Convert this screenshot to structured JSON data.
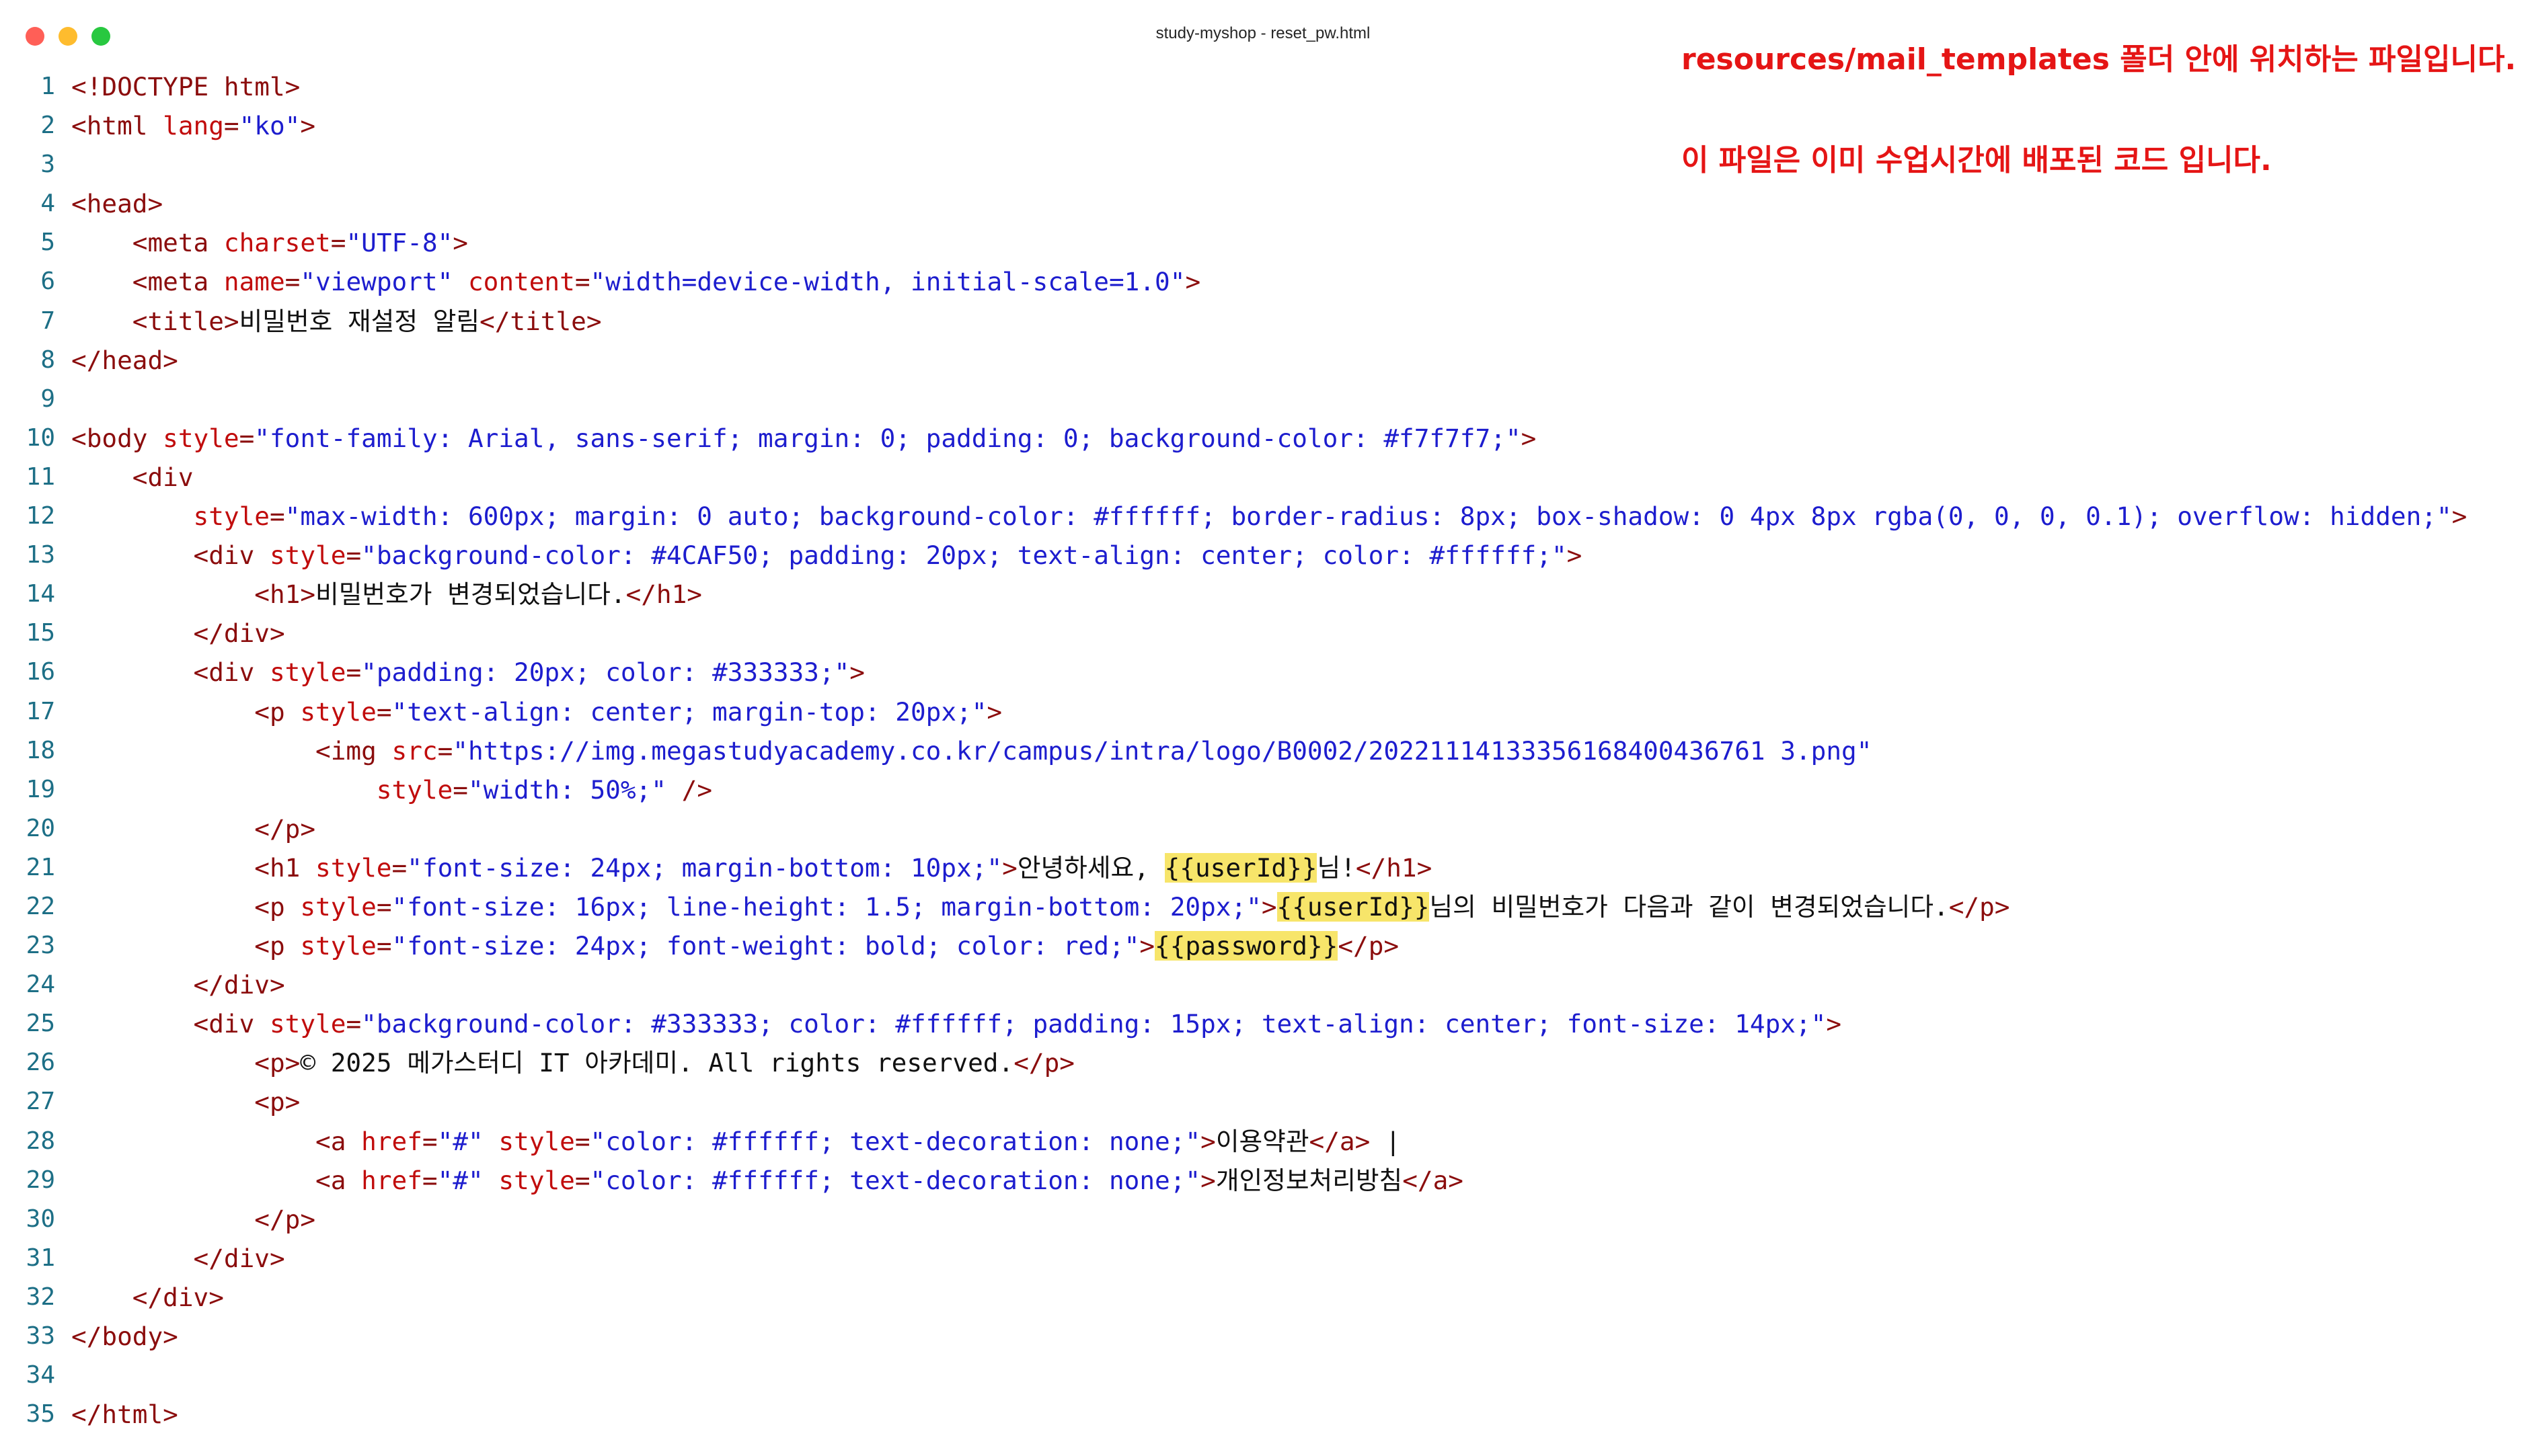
{
  "window": {
    "title": "study-myshop - reset_pw.html"
  },
  "annotations": [
    "resources/mail_templates 폴더 안에 위치하는 파일입니다.",
    "이 파일은 이미 수업시간에 배포된 코드 입니다."
  ],
  "editor": {
    "colors": {
      "line_number": "#1d6f86",
      "tag": "#8b0d0d",
      "attribute": "#c10c0c",
      "string": "#1d1dce",
      "text": "#111111",
      "highlight": "#f7e56a",
      "annotation": "#e51515"
    },
    "lines": [
      {
        "num": "1",
        "tokens": [
          {
            "type": "tag",
            "text": "<!DOCTYPE html>"
          }
        ]
      },
      {
        "num": "2",
        "tokens": [
          {
            "type": "tag",
            "text": "<html "
          },
          {
            "type": "attr",
            "text": "lang"
          },
          {
            "type": "tag",
            "text": "="
          },
          {
            "type": "str",
            "text": "\"ko\""
          },
          {
            "type": "tag",
            "text": ">"
          }
        ]
      },
      {
        "num": "3",
        "tokens": []
      },
      {
        "num": "4",
        "tokens": [
          {
            "type": "tag",
            "text": "<head>"
          }
        ]
      },
      {
        "num": "5",
        "tokens": [
          {
            "type": "text",
            "text": "    "
          },
          {
            "type": "tag",
            "text": "<meta "
          },
          {
            "type": "attr",
            "text": "charset"
          },
          {
            "type": "tag",
            "text": "="
          },
          {
            "type": "str",
            "text": "\"UTF-8\""
          },
          {
            "type": "tag",
            "text": ">"
          }
        ]
      },
      {
        "num": "6",
        "tokens": [
          {
            "type": "text",
            "text": "    "
          },
          {
            "type": "tag",
            "text": "<meta "
          },
          {
            "type": "attr",
            "text": "name"
          },
          {
            "type": "tag",
            "text": "="
          },
          {
            "type": "str",
            "text": "\"viewport\""
          },
          {
            "type": "text",
            "text": " "
          },
          {
            "type": "attr",
            "text": "content"
          },
          {
            "type": "tag",
            "text": "="
          },
          {
            "type": "str",
            "text": "\"width=device-width, initial-scale=1.0\""
          },
          {
            "type": "tag",
            "text": ">"
          }
        ]
      },
      {
        "num": "7",
        "tokens": [
          {
            "type": "text",
            "text": "    "
          },
          {
            "type": "tag",
            "text": "<title>"
          },
          {
            "type": "text",
            "text": "비밀번호 재설정 알림"
          },
          {
            "type": "tag",
            "text": "</title>"
          }
        ]
      },
      {
        "num": "8",
        "tokens": [
          {
            "type": "tag",
            "text": "</head>"
          }
        ]
      },
      {
        "num": "9",
        "tokens": []
      },
      {
        "num": "10",
        "tokens": [
          {
            "type": "tag",
            "text": "<body "
          },
          {
            "type": "attr",
            "text": "style"
          },
          {
            "type": "tag",
            "text": "="
          },
          {
            "type": "str",
            "text": "\"font-family: Arial, sans-serif; margin: 0; padding: 0; background-color: #f7f7f7;\""
          },
          {
            "type": "tag",
            "text": ">"
          }
        ]
      },
      {
        "num": "11",
        "tokens": [
          {
            "type": "text",
            "text": "    "
          },
          {
            "type": "tag",
            "text": "<div"
          }
        ]
      },
      {
        "num": "12",
        "tokens": [
          {
            "type": "text",
            "text": "        "
          },
          {
            "type": "attr",
            "text": "style"
          },
          {
            "type": "tag",
            "text": "="
          },
          {
            "type": "str",
            "text": "\"max-width: 600px; margin: 0 auto; background-color: #ffffff; border-radius: 8px; box-shadow: 0 4px 8px rgba(0, 0, 0, 0.1); overflow: hidden;\""
          },
          {
            "type": "tag",
            "text": ">"
          }
        ]
      },
      {
        "num": "13",
        "tokens": [
          {
            "type": "text",
            "text": "        "
          },
          {
            "type": "tag",
            "text": "<div "
          },
          {
            "type": "attr",
            "text": "style"
          },
          {
            "type": "tag",
            "text": "="
          },
          {
            "type": "str",
            "text": "\"background-color: #4CAF50; padding: 20px; text-align: center; color: #ffffff;\""
          },
          {
            "type": "tag",
            "text": ">"
          }
        ]
      },
      {
        "num": "14",
        "tokens": [
          {
            "type": "text",
            "text": "            "
          },
          {
            "type": "tag",
            "text": "<h1>"
          },
          {
            "type": "text",
            "text": "비밀번호가 변경되었습니다."
          },
          {
            "type": "tag",
            "text": "</h1>"
          }
        ]
      },
      {
        "num": "15",
        "tokens": [
          {
            "type": "text",
            "text": "        "
          },
          {
            "type": "tag",
            "text": "</div>"
          }
        ]
      },
      {
        "num": "16",
        "tokens": [
          {
            "type": "text",
            "text": "        "
          },
          {
            "type": "tag",
            "text": "<div "
          },
          {
            "type": "attr",
            "text": "style"
          },
          {
            "type": "tag",
            "text": "="
          },
          {
            "type": "str",
            "text": "\"padding: 20px; color: #333333;\""
          },
          {
            "type": "tag",
            "text": ">"
          }
        ]
      },
      {
        "num": "17",
        "tokens": [
          {
            "type": "text",
            "text": "            "
          },
          {
            "type": "tag",
            "text": "<p "
          },
          {
            "type": "attr",
            "text": "style"
          },
          {
            "type": "tag",
            "text": "="
          },
          {
            "type": "str",
            "text": "\"text-align: center; margin-top: 20px;\""
          },
          {
            "type": "tag",
            "text": ">"
          }
        ]
      },
      {
        "num": "18",
        "tokens": [
          {
            "type": "text",
            "text": "                "
          },
          {
            "type": "tag",
            "text": "<img "
          },
          {
            "type": "attr",
            "text": "src"
          },
          {
            "type": "tag",
            "text": "="
          },
          {
            "type": "str",
            "text": "\"https://img.megastudyacademy.co.kr/campus/intra/logo/B0002/20221114133356168400436761 3.png\""
          }
        ]
      },
      {
        "num": "19",
        "tokens": [
          {
            "type": "text",
            "text": "                    "
          },
          {
            "type": "attr",
            "text": "style"
          },
          {
            "type": "tag",
            "text": "="
          },
          {
            "type": "str",
            "text": "\"width: 50%;\""
          },
          {
            "type": "text",
            "text": " "
          },
          {
            "type": "tag",
            "text": "/>"
          }
        ]
      },
      {
        "num": "20",
        "tokens": [
          {
            "type": "text",
            "text": "            "
          },
          {
            "type": "tag",
            "text": "</p>"
          }
        ]
      },
      {
        "num": "21",
        "tokens": [
          {
            "type": "text",
            "text": "            "
          },
          {
            "type": "tag",
            "text": "<h1 "
          },
          {
            "type": "attr",
            "text": "style"
          },
          {
            "type": "tag",
            "text": "="
          },
          {
            "type": "str",
            "text": "\"font-size: 24px; margin-bottom: 10px;\""
          },
          {
            "type": "tag",
            "text": ">"
          },
          {
            "type": "text",
            "text": "안녕하세요, "
          },
          {
            "type": "tpl",
            "text": "{{userId}}"
          },
          {
            "type": "text",
            "text": "님!"
          },
          {
            "type": "tag",
            "text": "</h1>"
          }
        ]
      },
      {
        "num": "22",
        "tokens": [
          {
            "type": "text",
            "text": "            "
          },
          {
            "type": "tag",
            "text": "<p "
          },
          {
            "type": "attr",
            "text": "style"
          },
          {
            "type": "tag",
            "text": "="
          },
          {
            "type": "str",
            "text": "\"font-size: 16px; line-height: 1.5; margin-bottom: 20px;\""
          },
          {
            "type": "tag",
            "text": ">"
          },
          {
            "type": "tpl",
            "text": "{{userId}}"
          },
          {
            "type": "text",
            "text": "님의 비밀번호가 다음과 같이 변경되었습니다."
          },
          {
            "type": "tag",
            "text": "</p>"
          }
        ]
      },
      {
        "num": "23",
        "tokens": [
          {
            "type": "text",
            "text": "            "
          },
          {
            "type": "tag",
            "text": "<p "
          },
          {
            "type": "attr",
            "text": "style"
          },
          {
            "type": "tag",
            "text": "="
          },
          {
            "type": "str",
            "text": "\"font-size: 24px; font-weight: bold; color: red;\""
          },
          {
            "type": "tag",
            "text": ">"
          },
          {
            "type": "tpl",
            "text": "{{password}}"
          },
          {
            "type": "tag",
            "text": "</p>"
          }
        ]
      },
      {
        "num": "24",
        "tokens": [
          {
            "type": "text",
            "text": "        "
          },
          {
            "type": "tag",
            "text": "</div>"
          }
        ]
      },
      {
        "num": "25",
        "tokens": [
          {
            "type": "text",
            "text": "        "
          },
          {
            "type": "tag",
            "text": "<div "
          },
          {
            "type": "attr",
            "text": "style"
          },
          {
            "type": "tag",
            "text": "="
          },
          {
            "type": "str",
            "text": "\"background-color: #333333; color: #ffffff; padding: 15px; text-align: center; font-size: 14px;\""
          },
          {
            "type": "tag",
            "text": ">"
          }
        ]
      },
      {
        "num": "26",
        "tokens": [
          {
            "type": "text",
            "text": "            "
          },
          {
            "type": "tag",
            "text": "<p>"
          },
          {
            "type": "text",
            "text": "© 2025 메가스터디 IT 아카데미. All rights reserved."
          },
          {
            "type": "tag",
            "text": "</p>"
          }
        ]
      },
      {
        "num": "27",
        "tokens": [
          {
            "type": "text",
            "text": "            "
          },
          {
            "type": "tag",
            "text": "<p>"
          }
        ]
      },
      {
        "num": "28",
        "tokens": [
          {
            "type": "text",
            "text": "                "
          },
          {
            "type": "tag",
            "text": "<a "
          },
          {
            "type": "attr",
            "text": "href"
          },
          {
            "type": "tag",
            "text": "="
          },
          {
            "type": "str",
            "text": "\"#\""
          },
          {
            "type": "text",
            "text": " "
          },
          {
            "type": "attr",
            "text": "style"
          },
          {
            "type": "tag",
            "text": "="
          },
          {
            "type": "str",
            "text": "\"color: #ffffff; text-decoration: none;\""
          },
          {
            "type": "tag",
            "text": ">"
          },
          {
            "type": "text",
            "text": "이용약관"
          },
          {
            "type": "tag",
            "text": "</a>"
          },
          {
            "type": "text",
            "text": " |"
          }
        ]
      },
      {
        "num": "29",
        "tokens": [
          {
            "type": "text",
            "text": "                "
          },
          {
            "type": "tag",
            "text": "<a "
          },
          {
            "type": "attr",
            "text": "href"
          },
          {
            "type": "tag",
            "text": "="
          },
          {
            "type": "str",
            "text": "\"#\""
          },
          {
            "type": "text",
            "text": " "
          },
          {
            "type": "attr",
            "text": "style"
          },
          {
            "type": "tag",
            "text": "="
          },
          {
            "type": "str",
            "text": "\"color: #ffffff; text-decoration: none;\""
          },
          {
            "type": "tag",
            "text": ">"
          },
          {
            "type": "text",
            "text": "개인정보처리방침"
          },
          {
            "type": "tag",
            "text": "</a>"
          }
        ]
      },
      {
        "num": "30",
        "tokens": [
          {
            "type": "text",
            "text": "            "
          },
          {
            "type": "tag",
            "text": "</p>"
          }
        ]
      },
      {
        "num": "31",
        "tokens": [
          {
            "type": "text",
            "text": "        "
          },
          {
            "type": "tag",
            "text": "</div>"
          }
        ]
      },
      {
        "num": "32",
        "tokens": [
          {
            "type": "text",
            "text": "    "
          },
          {
            "type": "tag",
            "text": "</div>"
          }
        ]
      },
      {
        "num": "33",
        "tokens": [
          {
            "type": "tag",
            "text": "</body>"
          }
        ]
      },
      {
        "num": "34",
        "tokens": []
      },
      {
        "num": "35",
        "tokens": [
          {
            "type": "tag",
            "text": "</html>"
          }
        ]
      }
    ]
  }
}
